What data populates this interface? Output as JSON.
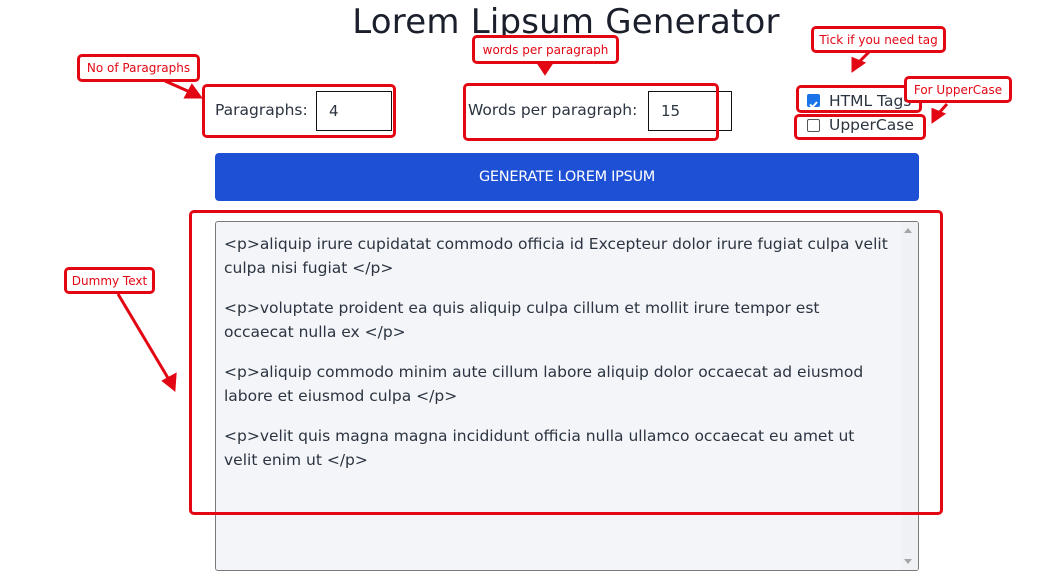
{
  "header": {
    "title": "Lorem Lipsum Generator"
  },
  "form": {
    "paragraphs_label": "Paragraphs:",
    "paragraphs_value": "4",
    "words_label": "Words per paragraph:",
    "words_value": "15",
    "html_tags": {
      "label": "HTML Tags",
      "checked": true
    },
    "uppercase": {
      "label": "UpperCase",
      "checked": false
    },
    "generate_label": "GENERATE LOREM IPSUM"
  },
  "output": {
    "paragraphs": [
      "<p>aliquip irure cupidatat commodo officia id Excepteur dolor irure fugiat culpa velit culpa nisi fugiat </p>",
      "<p>voluptate proident ea quis aliquip culpa cillum et mollit irure tempor est occaecat nulla ex </p>",
      "<p>aliquip commodo minim aute cillum labore aliquip dolor occaecat ad eiusmod labore et eiusmod culpa </p>",
      "<p>velit quis magna magna incididunt officia nulla ullamco occaecat eu amet ut velit enim ut </p>"
    ]
  },
  "annotations": {
    "no_of_paragraphs": "No of Paragraphs",
    "words_per_paragraph": "words per paragraph",
    "tick_if_tag": "Tick if you need tag",
    "for_uppercase": "For UpperCase",
    "dummy_text": "Dummy Text",
    "color": "#e30613"
  }
}
